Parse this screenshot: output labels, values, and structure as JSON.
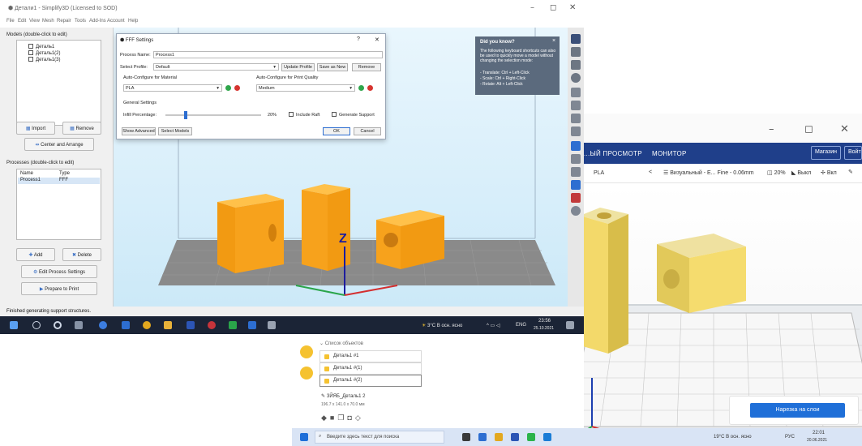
{
  "cura": {
    "window_min": "–",
    "window_restore": "◻",
    "window_close": "✕",
    "header_tabs": [
      "...ЫЙ ПРОСМОТР",
      "МОНИТОР"
    ],
    "market_button": "Магазин",
    "login_button": "Войти",
    "toolbar": {
      "material": "PLA",
      "chevron": "<",
      "profile": "Визуальный - E... Fine - 0.06mm",
      "infill": "20%",
      "support": "Выкл",
      "adhesion": "Вкл"
    },
    "objects": {
      "header": "Список объектов",
      "items": [
        "Деталь1 #1",
        "Деталь1 #(1)",
        "Деталь1 #(2)"
      ]
    },
    "object_name": "ЗЙЯБ_Деталь1 2",
    "object_dims": "196.7 x 141.0 x 70.0 мм",
    "slice_button": "Нарезка на слои",
    "taskbar": {
      "search": "Введите здесь текст для поиска",
      "weather": "19°C В осн. ясно",
      "lang": "РУС",
      "time": "22:01",
      "date": "20.06.2021"
    }
  },
  "s3d": {
    "title": "Детали1 - Simplify3D (Licensed to SOD)",
    "window_min": "–",
    "window_max": "◻",
    "window_close": "✕",
    "menu": [
      "File",
      "Edit",
      "View",
      "Mesh",
      "Repair",
      "Tools",
      "Add-Ins",
      "Account",
      "Help"
    ],
    "models_header": "Models (double-click to edit)",
    "models": [
      "Деталь1",
      "Деталь1(2)",
      "Деталь1(3)"
    ],
    "import_button": "Import",
    "remove_button": "Remove",
    "center_button": "Center and Arrange",
    "processes_header": "Processes (double-click to edit)",
    "col_name": "Name",
    "col_type": "Type",
    "process_name": "Process1",
    "process_type": "FFF",
    "add_button": "Add",
    "delete_button": "Delete",
    "edit_process_button": "Edit Process Settings",
    "prepare_button": "Prepare to Print",
    "status": "Finished generating support structures.",
    "axis_label": "Z"
  },
  "dialog": {
    "title": "FFF Settings",
    "help": "?",
    "close": "✕",
    "process_name_label": "Process Name:",
    "process_name_value": "Process1",
    "profile_label": "Select Profile:",
    "profile_value": "Default",
    "update_profile": "Update Profile",
    "save_as_new": "Save as New",
    "remove": "Remove",
    "auto_material_label": "Auto-Configure for Material",
    "material_value": "PLA",
    "auto_quality_label": "Auto-Configure for Print Quality",
    "quality_value": "Medium",
    "general_label": "General Settings",
    "infill_label": "Infill Percentage:",
    "infill_value": "20%",
    "infill_fraction": 0.2,
    "include_raft": "Include Raft",
    "generate_support": "Generate Support",
    "show_advanced": "Show Advanced",
    "select_models": "Select Models",
    "ok": "OK",
    "cancel": "Cancel"
  },
  "tip": {
    "title": "Did you know?",
    "close": "×",
    "body": "The following keyboard shortcuts can also be used to quickly move a model without changing the selection mode:",
    "shortcuts": [
      "- Translate: Ctrl + Left-Click",
      "- Scale: Ctrl + Right-Click",
      "- Rotate: Alt + Left-Click"
    ]
  },
  "taskbar": {
    "weather": "3°C В осн. ясно",
    "lang": "ENG",
    "time": "23:56",
    "date": "25.10.2021"
  },
  "colors": {
    "model_orange": "#f7a21c",
    "cura_header": "#1f3f8a",
    "cura_model_yellow": "#f7d565",
    "s3d_viewport": "#d8effb",
    "taskbar_dark": "#1b2436",
    "slice_blue": "#1f6fd8"
  }
}
